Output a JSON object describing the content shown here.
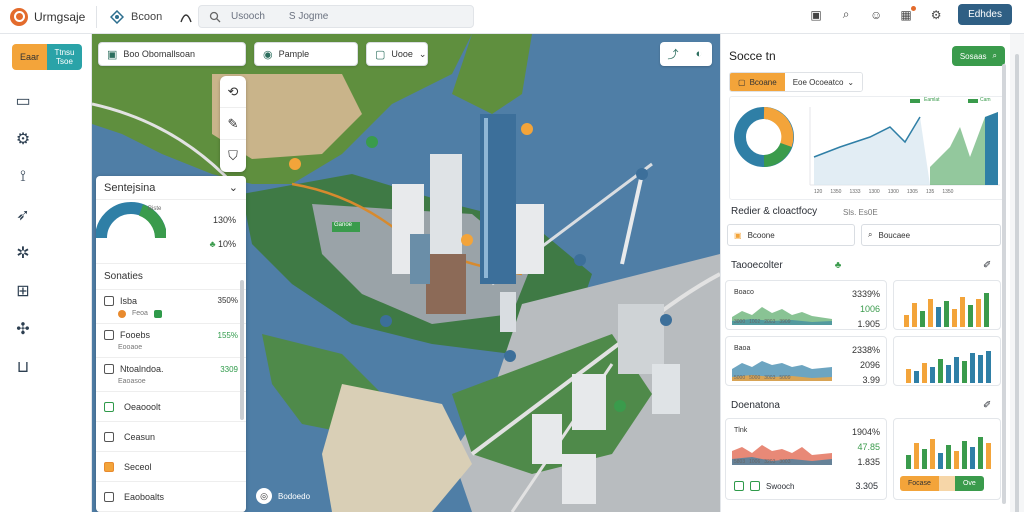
{
  "topbar": {
    "brand": "Urmgsaje",
    "nav_label": "Bcoon",
    "search_text": "Usooch",
    "search_tag": "S Jogme",
    "action_button": "Edhdes"
  },
  "nav": {
    "toggle_a": "Eaar",
    "toggle_b": "Ttnsu Tsoe"
  },
  "map": {
    "filter_chip": "Boo Obomallsoan",
    "place_chip": "Pample",
    "dropdown_chip": "Uooe",
    "map_note": "Bodoedo",
    "map_label": "Ganoe"
  },
  "float_panel": {
    "title": "Sentejsina",
    "gauge_small": "Biste",
    "gauge_val1": "130%",
    "gauge_val2": "10%",
    "section": "Sonaties",
    "items": [
      {
        "title": "Isba",
        "sub": "Feoa",
        "value": "350%"
      },
      {
        "title": "Fooebs",
        "sub": "Eooaoe",
        "value": "155%"
      },
      {
        "title": "Ntoalndoa.",
        "sub": "Eaoasoe",
        "value": "3309"
      },
      {
        "title": "Oeaooolt"
      },
      {
        "title": "Ceasun"
      },
      {
        "title": "Seceol"
      },
      {
        "title": "Eaoboalts"
      }
    ]
  },
  "right_panel": {
    "title": "Socce tn",
    "head_button": "Sosaas",
    "tab1": "Bcoane",
    "tab2": "Eoe  Ocoeatco",
    "chart_top_labels": [
      "Eamlat",
      "Cam"
    ],
    "chart_x_labels": [
      "120",
      "1350",
      "1333",
      "1300",
      "1300",
      "1305",
      "135",
      "1350"
    ],
    "section2_title": "Redier & cloactfocy",
    "section2_sub": "Sls. Es0E",
    "input1": "Bcoone",
    "input2": "Boucaee",
    "section3_title": "Taooecolter",
    "section4_title": "Doenatona",
    "card1": {
      "label": "Boaco",
      "values": [
        "3339%",
        "1006",
        "1.905"
      ],
      "axis": [
        "3000",
        "1002",
        "2003",
        "3909"
      ]
    },
    "card3": {
      "label": "Baoa",
      "values": [
        "2338%",
        "2096",
        "3.99"
      ],
      "axis": [
        "5000",
        "5000",
        "3003",
        "5009"
      ]
    },
    "card5": {
      "label": "Tlnk",
      "values": [
        "1904%",
        "47.85",
        "1.835"
      ],
      "axis": [
        "5803",
        "1006",
        "3203",
        "3003"
      ]
    },
    "footer_chip": "Swooch",
    "footer_value": "3.305",
    "seg_a": "Focase",
    "seg_b": "",
    "seg_c": "Ove"
  },
  "colors": {
    "accent_orange": "#f3a43a",
    "accent_teal": "#2aa3a8",
    "accent_green": "#3a9b4c",
    "primary_blue": "#2f5f84"
  }
}
